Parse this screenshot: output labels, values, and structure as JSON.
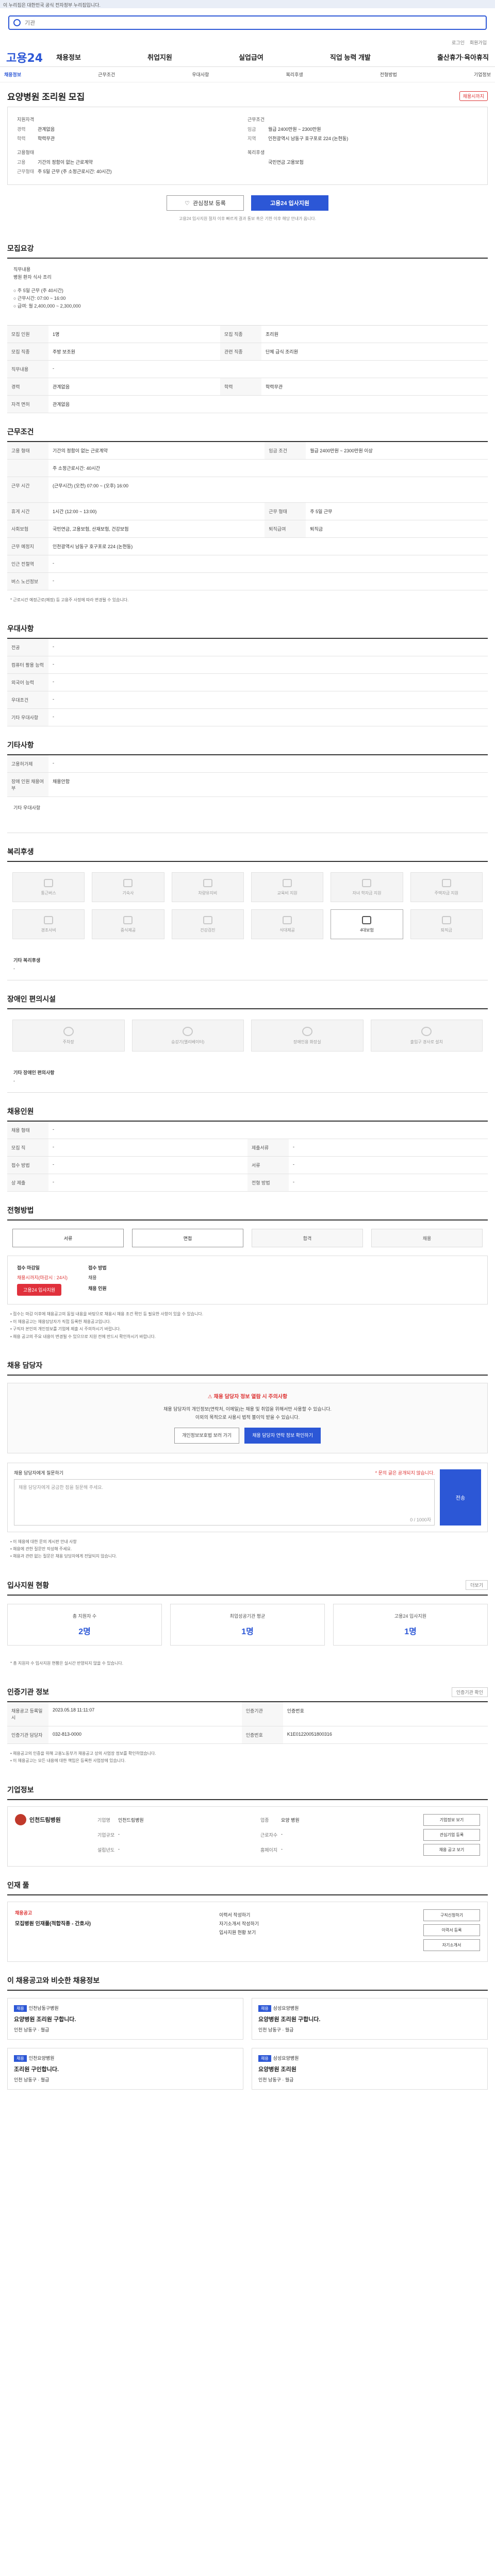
{
  "topbar": {
    "text": "이 누리집은 대한민국 공식 전자정부 누리집입니다."
  },
  "search": {
    "placeholder": "기관"
  },
  "util": {
    "login": "로그인",
    "join": "회원가입"
  },
  "gnb": {
    "logo": "고용24",
    "menu": [
      "채용정보",
      "취업지원",
      "실업급여",
      "직업 능력 개발",
      "출산휴가·육아휴직"
    ]
  },
  "subnav": [
    "채용정보",
    "근무조건",
    "우대사항",
    "복리후생",
    "전형방법",
    "기업정보"
  ],
  "job": {
    "title": "요양병원 조리원 모집",
    "badge": "채용시까지",
    "company_label": "지원자격",
    "conditions_label": "근무조건",
    "left": [
      {
        "k": "경력",
        "v": "관계없음"
      },
      {
        "k": "학력",
        "v": "학력무관"
      }
    ],
    "left2_label": "고용형태",
    "left2": [
      {
        "k": "고용",
        "v": "기간의 정함이 없는 근로계약"
      },
      {
        "k": "근무형태",
        "v": "주 5일 근무 (주 소정근로시간: 40시간)"
      }
    ],
    "right": [
      {
        "k": "임금",
        "v": "월급 2400만원 ~ 2300만원"
      },
      {
        "k": "지역",
        "v": "인천광역시 남동구 호구포로 224 (논현동)"
      }
    ],
    "right2_label": "복리후생",
    "right2": [
      {
        "k": "",
        "v": "국민연금 고용보험"
      }
    ],
    "btn_scrap": "관심정보 등록",
    "btn_apply": "고용24 입사지원",
    "note": "고용24 입사지원 절차 이후 빠르게 결과 통보 혹은 기한 이후 해당 안내가 옵니다."
  },
  "recruit": {
    "title": "모집요강",
    "desc_lines": [
      "직무내용",
      "병원 환자 식사 조리",
      "",
      "○ 주 5일 근무 (주 40시간)",
      "○ 근무시간: 07:00 ~ 16:00",
      "○ 급여: 월 2,400,000 ~ 2,300,000"
    ],
    "rows": [
      {
        "h": "모집 인원",
        "v": "1명",
        "h2": "모집 직종",
        "v2": "조리원"
      },
      {
        "h": "모집 직종",
        "v": "주방 보조원",
        "h2": "관련 직종",
        "v2": "단체 급식 조리원"
      },
      {
        "h": "직무내용",
        "v": "-",
        "h2": "",
        "v2": ""
      },
      {
        "h": "경력",
        "v": "관계없음",
        "h2": "학력",
        "v2": "학력무관"
      },
      {
        "h": "자격 면허",
        "v": "관계없음",
        "h2": "",
        "v2": ""
      }
    ]
  },
  "workcond": {
    "title": "근무조건",
    "rows": [
      {
        "h": "고용 형태",
        "v": "기간의 정함이 없는 근로계약",
        "h2": "임금 조건",
        "v2": "월급 2400만원 ~ 2300만원 이상"
      },
      {
        "h": "",
        "v": "주 소정근로시간: 40시간",
        "h2": "",
        "v2": ""
      },
      {
        "h": "근무 시간",
        "v": "(근무시간) (오전) 07:00 ~ (오후) 16:00",
        "h2": "",
        "v2": ""
      },
      {
        "h": "휴게 시간",
        "v": "1시간 (12:00 ~ 13:00)",
        "h2": "근무 형태",
        "v2": "주 5일 근무"
      },
      {
        "h": "사회보험",
        "v": "국민연금, 고용보험, 산재보험, 건강보험",
        "h2": "퇴직급여",
        "v2": "퇴직금"
      },
      {
        "h": "근무 예정지",
        "v": "인천광역시 남동구 호구포로 224 (논현동)",
        "h2": "",
        "v2": ""
      },
      {
        "h": "인근 전철역",
        "v": "-",
        "h2": "",
        "v2": ""
      },
      {
        "h": "버스 노선정보",
        "v": "-",
        "h2": "",
        "v2": ""
      }
    ],
    "note": "* 근로시간 예정근로(예정) 등 고용주 사정에 따라 변경될 수 있습니다."
  },
  "pref": {
    "title": "우대사항",
    "rows": [
      {
        "h": "전공",
        "v": "-"
      },
      {
        "h": "컴퓨터 활용 능력",
        "v": "-"
      },
      {
        "h": "외국어 능력",
        "v": "-"
      },
      {
        "h": "우대조건",
        "v": "-"
      },
      {
        "h": "기타 우대사항",
        "v": "-"
      }
    ]
  },
  "etc": {
    "title": "기타사항",
    "rows": [
      {
        "h": "고용허가제",
        "v": "-"
      },
      {
        "h": "장애 인원 채용여부",
        "v": "채용안함"
      }
    ],
    "extra": "기타 우대사항"
  },
  "welfare": {
    "title": "복리후생",
    "items": [
      "통근버스",
      "기숙사",
      "차량유지비",
      "교육비 지원",
      "자녀 학자금 지원",
      "주택자금 지원",
      "경조사비",
      "중식제공",
      "건강검진",
      "식대제공",
      "4대보험",
      "퇴직금"
    ],
    "on_index": 10,
    "extra_label": "기타 복리후생",
    "extra_value": "-"
  },
  "disab": {
    "title": "장애인 편의시설",
    "items": [
      "주차장",
      "승강기(엘리베이터)",
      "장애인용 화장실",
      "출입구 경사로 설치"
    ],
    "extra_label": "기타 장애인 편의사항",
    "extra_value": "-"
  },
  "hrinfo": {
    "title": "채용인원",
    "rows": [
      {
        "h": "채용 형태",
        "v": "-",
        "h2": "",
        "v2": ""
      },
      {
        "h": "모집 직",
        "v": "-",
        "h2": "제출서류",
        "v2": "-"
      },
      {
        "h": "접수 방법",
        "v": "-",
        "h2": "서류",
        "v2": "-"
      },
      {
        "h": "상 제출",
        "v": "-",
        "h2": "전형 방법",
        "v2": "-"
      }
    ]
  },
  "process": {
    "title": "전형방법",
    "steps": [
      "서류",
      "면접",
      "합격",
      "채용"
    ],
    "apply_deadline_label": "접수 마감일",
    "apply_deadline": "채용시까지(마감시 : 24시)",
    "apply_method_label": "접수 방법",
    "apply_method": "채용",
    "apply_method2": "채용 인원",
    "apply_btn": "고용24 입사지원",
    "bullets": [
      "• 접수는 마감 이후에 채용공고의 동일 내용을 바탕으로 채용시 채용 조건 확인 등 필요한 사항이 있을 수 있습니다.",
      "• 이 채용공고는 채용담당자가 직접 등록한 채용공고입니다.",
      "• 구직자 본인의 개인정보를 기업에 제출 시 주의하시기 바랍니다.",
      "• 채용 공고의 주요 내용이 변경될 수 있으므로 지원 전에 반드시 확인하시기 바랍니다."
    ]
  },
  "contact": {
    "title": "채용 담당자",
    "warn_title": "채용 담당자 정보 열람 시 주의사항",
    "warn_lines": [
      "채용 담당자의 개인정보(연락처, 이메일)는 채용 및 취업을 위해서만 사용할 수 있습니다.",
      "이외의 목적으로 사용시 법적 불이익 받을 수 있습니다."
    ],
    "btn1": "개인정보보호법 보러 가기",
    "btn2": "채용 담당자 연락 정보 확인하기"
  },
  "inquiry": {
    "label": "채용 담당자에게 질문하기",
    "side_note": "* 문의 글은 공개되지 않습니다.",
    "placeholder": "채용 담당자에게 궁금한 점을 질문해 주세요.",
    "counter": "0 / 1000자",
    "submit": "전송",
    "notes": [
      "• 이 채용에 대한 문의 게시판 안내 사항",
      "• 채용에 관한 질문만 작성해 주세요.",
      "• 채용과 관련 없는 질문은 채용 담당자에게 전달되지 않습니다."
    ]
  },
  "status": {
    "title": "입사지원 현황",
    "more": "더보기",
    "items": [
      {
        "label": "총 지원자 수",
        "value": "2명"
      },
      {
        "label": "최업성공기관 평균",
        "value": "1명"
      },
      {
        "label": "고용24 입사지원",
        "value": "1명"
      }
    ],
    "note": "* 총 지원자 수 입사지원 현황은 실시간 반영되지 않을 수 있습니다."
  },
  "certify": {
    "title": "인증기관 정보",
    "btn": "인증기관 확인",
    "rows": [
      {
        "h": "채용공고 등록일시",
        "v": "2023.05.18 11:11:07",
        "h2": "인증기관",
        "v2": "인증번호"
      },
      {
        "h": "인증기관 담당자",
        "v": "032-813-0000",
        "h2": "인증번호",
        "v2": "K1E01220051800316"
      }
    ],
    "notes": [
      "• 채용공고의 인증을 위해 고용노동부가 채용공고 상의 사업장 정보를 확인하였습니다.",
      "• 이 채용공고는 모든 내용에 대한 책임은 등록한 사업장에 있습니다."
    ]
  },
  "company": {
    "title": "기업정보",
    "name": "인천드림병원",
    "rows": [
      {
        "k": "기업명",
        "v": "인천드림병원"
      },
      {
        "k": "업종",
        "v": "요양 병원"
      },
      {
        "k": "기업규모",
        "v": "-"
      },
      {
        "k": "근로자수",
        "v": "-"
      },
      {
        "k": "설립년도",
        "v": "-"
      },
      {
        "k": "홈페이지",
        "v": "-"
      }
    ],
    "side_btns": [
      "기업정보 보기",
      "관심기업 등록",
      "채용 공고 보기"
    ]
  },
  "pool": {
    "title": "인재 풀",
    "label": "채용공고",
    "text": "모집병원 인재풀(적합직종 - 간호사)",
    "items": [
      "이력서 작성하기",
      "자기소개서 작성하기",
      "입사지원 현황 보기"
    ],
    "btns": [
      "구직신청하기",
      "이력서 등록",
      "자기소개서"
    ]
  },
  "similar": {
    "title": "이 채용공고와 비슷한 채용정보",
    "cards": [
      {
        "tag": "채용",
        "org": "인천남동구병원",
        "title": "요양병원 조리원 구합니다.",
        "loc": "인천 남동구",
        "pay": "월급"
      },
      {
        "tag": "채용",
        "org": "삼성요양병원",
        "title": "요양병원 조리원 구합니다.",
        "loc": "인천 남동구",
        "pay": "월급"
      },
      {
        "tag": "채용",
        "org": "인천요양병원",
        "title": "조리원 구인합니다.",
        "loc": "인천 남동구",
        "pay": "월급"
      },
      {
        "tag": "채용",
        "org": "삼성요양병원",
        "title": "요양병원 조리원",
        "loc": "인천 남동구",
        "pay": "월급"
      }
    ]
  }
}
